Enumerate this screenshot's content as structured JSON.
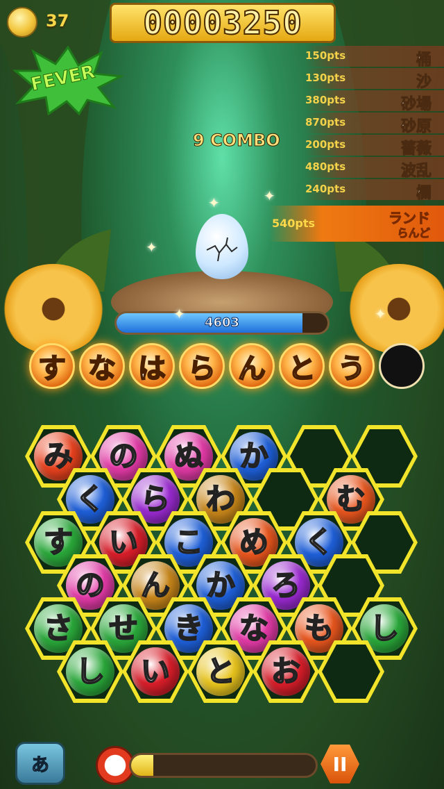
{
  "hud": {
    "coins": "37",
    "score": "00003250",
    "fever_label": "FEVER",
    "combo": "9 COMBO"
  },
  "word_history": [
    {
      "pts": "150pts",
      "word": "桶"
    },
    {
      "pts": "130pts",
      "word": "沙"
    },
    {
      "pts": "380pts",
      "word": "砂場"
    },
    {
      "pts": "870pts",
      "word": "砂原"
    },
    {
      "pts": "200pts",
      "word": "薔薇"
    },
    {
      "pts": "480pts",
      "word": "波乱"
    },
    {
      "pts": "240pts",
      "word": "欄"
    }
  ],
  "current_word": {
    "pts": "540pts",
    "word": "ランド",
    "reading": "らんど"
  },
  "enemy": {
    "hp_text": "4603",
    "hp_fraction": 0.88
  },
  "word_chain": [
    "す",
    "な",
    "は",
    "ら",
    "ん",
    "と",
    "う",
    ""
  ],
  "board": [
    [
      {
        "c": "み",
        "color": "#e8421e"
      },
      {
        "c": "の",
        "color": "#e23aa6"
      },
      {
        "c": "ぬ",
        "color": "#e23aa6"
      },
      {
        "c": "か",
        "color": "#1e5fd8"
      },
      {
        "c": "",
        "color": ""
      },
      {
        "c": "",
        "color": ""
      }
    ],
    [
      {
        "c": "く",
        "color": "#1e5fd8"
      },
      {
        "c": "ら",
        "color": "#9a2ad0"
      },
      {
        "c": "わ",
        "color": "#c8861a"
      },
      {
        "c": "",
        "color": ""
      },
      {
        "c": "む",
        "color": "#e8561e"
      }
    ],
    [
      {
        "c": "す",
        "color": "#2aa83a"
      },
      {
        "c": "い",
        "color": "#d81e2a"
      },
      {
        "c": "こ",
        "color": "#1e5fd8"
      },
      {
        "c": "め",
        "color": "#e8561e"
      },
      {
        "c": "く",
        "color": "#1e5fd8"
      },
      {
        "c": "",
        "color": ""
      }
    ],
    [
      {
        "c": "の",
        "color": "#e23aa6"
      },
      {
        "c": "ん",
        "color": "#c8861a"
      },
      {
        "c": "か",
        "color": "#1e5fd8"
      },
      {
        "c": "ろ",
        "color": "#9a2ad0"
      },
      {
        "c": "",
        "color": ""
      }
    ],
    [
      {
        "c": "さ",
        "color": "#2aa83a"
      },
      {
        "c": "せ",
        "color": "#2aa83a"
      },
      {
        "c": "き",
        "color": "#1e5fd8"
      },
      {
        "c": "な",
        "color": "#e23aa6"
      },
      {
        "c": "も",
        "color": "#e8561e"
      },
      {
        "c": "し",
        "color": "#2aa83a"
      }
    ],
    [
      {
        "c": "し",
        "color": "#2aa83a"
      },
      {
        "c": "い",
        "color": "#d81e2a"
      },
      {
        "c": "と",
        "color": "#e8c41e"
      },
      {
        "c": "お",
        "color": "#d81e2a"
      },
      {
        "c": "",
        "color": ""
      }
    ]
  ],
  "controls": {
    "swap_label": "あ",
    "pause_label": "II",
    "time_fraction": 0.12
  }
}
